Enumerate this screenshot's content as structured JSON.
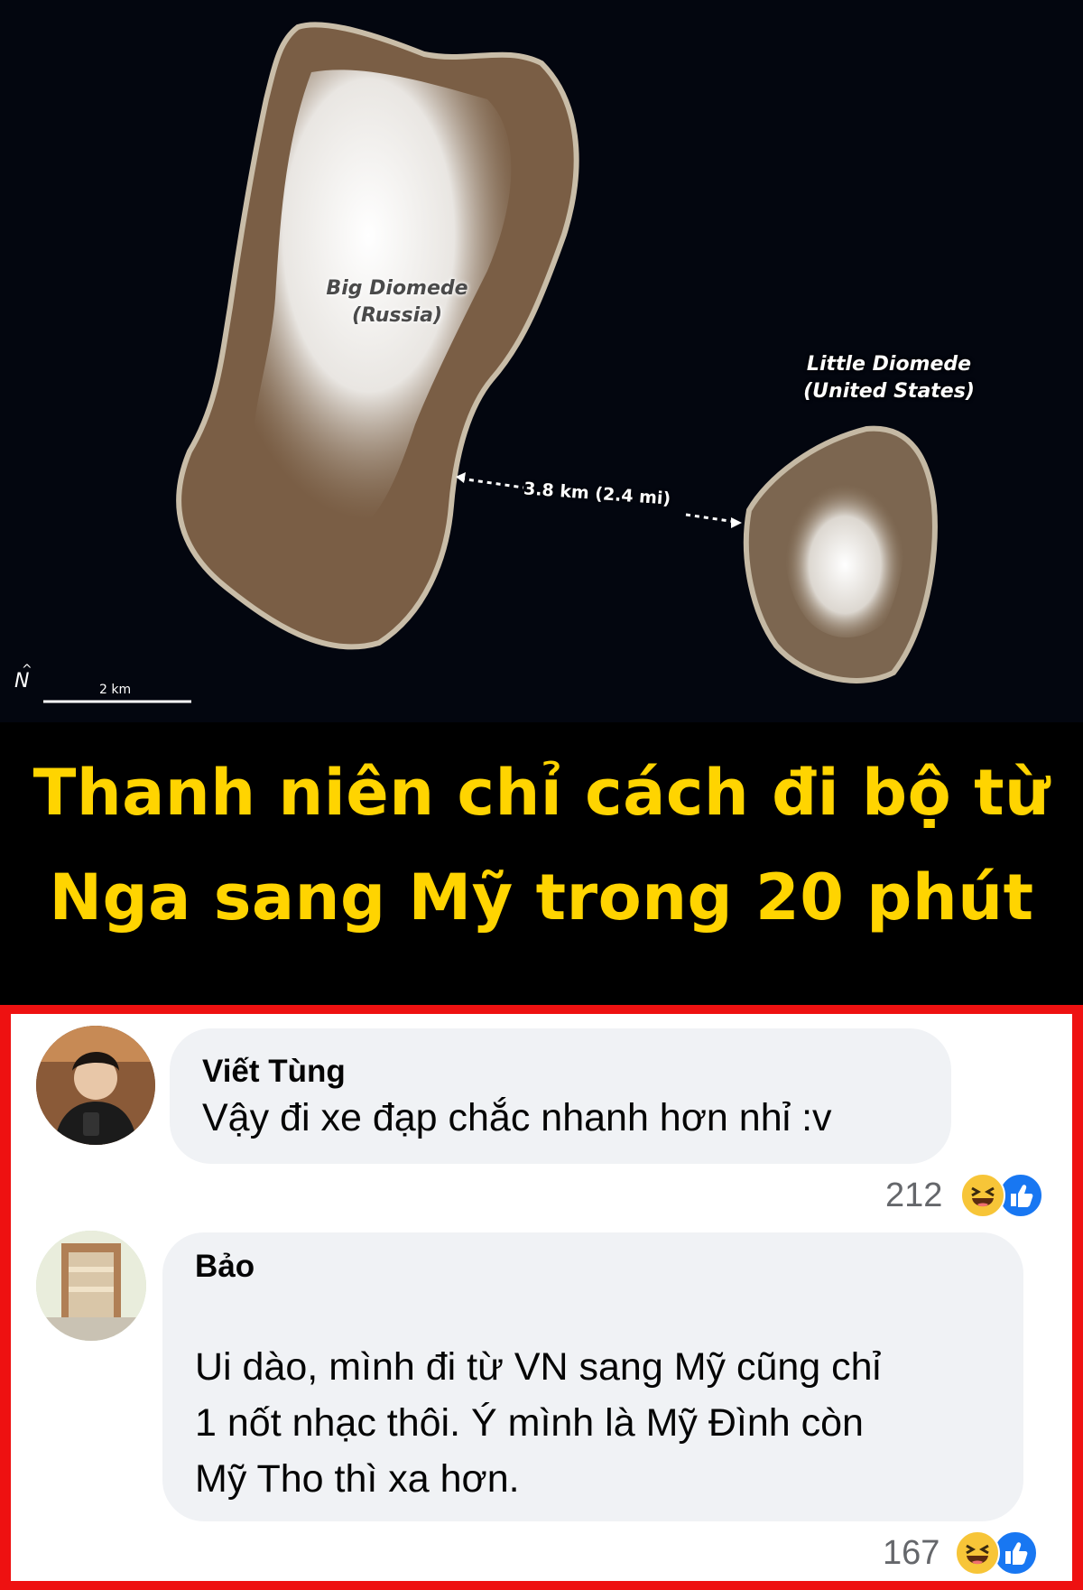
{
  "map": {
    "big_island_name": "Big Diomede",
    "big_island_country": "(Russia)",
    "little_island_name": "Little Diomede",
    "little_island_country": "(United States)",
    "distance": "3.8 km (2.4 mi)",
    "scale": "2 km",
    "north_symbol": "N"
  },
  "headline": {
    "line1": "Thanh niên chỉ cách đi bộ từ",
    "line2": "Nga sang Mỹ trong 20 phút"
  },
  "comments": [
    {
      "author": "Viết Tùng",
      "text_lines": [
        "Vậy đi xe đạp chắc nhanh hơn nhỉ :v"
      ],
      "reaction_count": "212",
      "reactions": [
        "haha-icon",
        "like-icon"
      ]
    },
    {
      "author": "Bảo",
      "text_lines": [
        "Ui dào, mình đi từ VN sang Mỹ cũng chỉ",
        "1 nốt nhạc thôi. Ý mình là Mỹ Đình còn",
        "Mỹ Tho thì xa hơn."
      ],
      "reaction_count": "167",
      "reactions": [
        "haha-icon",
        "like-icon"
      ]
    }
  ],
  "colors": {
    "headline": "#ffd400",
    "frame": "#ee1111",
    "bubble": "#f0f2f5",
    "like": "#1877f2",
    "haha": "#f7c538"
  }
}
